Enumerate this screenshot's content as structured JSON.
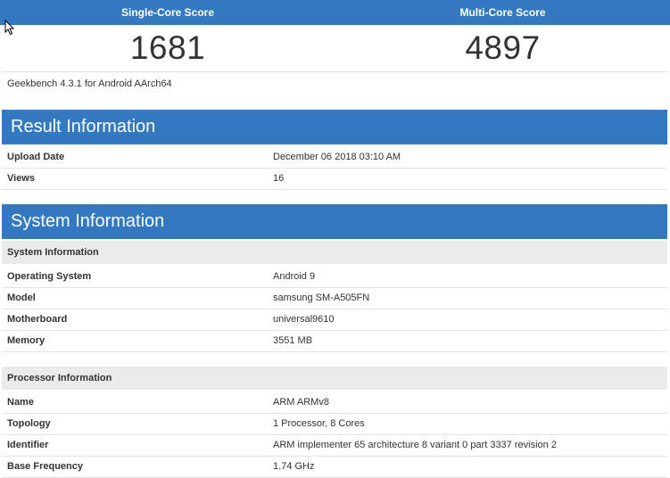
{
  "scores": {
    "single": {
      "label": "Single-Core Score",
      "value": "1681"
    },
    "multi": {
      "label": "Multi-Core Score",
      "value": "4897"
    }
  },
  "version": "Geekbench 4.3.1 for Android AArch64",
  "result": {
    "title": "Result Information",
    "rows": [
      {
        "key": "Upload Date",
        "value": "December 06 2018 03:10 AM"
      },
      {
        "key": "Views",
        "value": "16"
      }
    ]
  },
  "system": {
    "title": "System Information",
    "sys_sub": "System Information",
    "sys_rows": [
      {
        "key": "Operating System",
        "value": "Android 9"
      },
      {
        "key": "Model",
        "value": "samsung SM-A505FN"
      },
      {
        "key": "Motherboard",
        "value": "universal9610"
      },
      {
        "key": "Memory",
        "value": "3551 MB"
      }
    ],
    "proc_sub": "Processor Information",
    "proc_rows": [
      {
        "key": "Name",
        "value": "ARM ARMv8"
      },
      {
        "key": "Topology",
        "value": "1 Processor, 8 Cores"
      },
      {
        "key": "Identifier",
        "value": "ARM implementer 65 architecture 8 variant 0 part 3337 revision 2"
      },
      {
        "key": "Base Frequency",
        "value": "1.74 GHz"
      }
    ]
  },
  "colors": {
    "header": "#3379c1",
    "subhead": "#ebebeb"
  }
}
